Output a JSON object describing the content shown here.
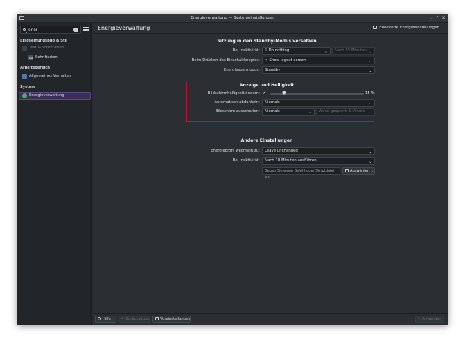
{
  "window": {
    "title": "Energieverwaltung — Systemeinstellungen"
  },
  "sidebar": {
    "search_value": "ener",
    "sections": [
      {
        "label": "Erscheinungsbild & Stil"
      },
      {
        "label": "Arbeitsbereich"
      },
      {
        "label": "System"
      }
    ],
    "items": [
      {
        "label": "Text & Schriftarten"
      },
      {
        "label": "Schriftarten"
      },
      {
        "label": "Allgemeines Verhalten"
      },
      {
        "label": "Energieverwaltung"
      }
    ]
  },
  "main": {
    "title": "Energieverwaltung",
    "advanced_button": "Erweiterte Energieeinstellungen …"
  },
  "standby": {
    "title": "Sitzung in den Standby-Modus versetzen",
    "rows": [
      {
        "label": "Bei Inaktivität:",
        "value": "Do nothing",
        "secondary": "Nach 25 Minuten"
      },
      {
        "label": "Beim Drücken des Einschaltknopfes:",
        "value": "Show logout screen"
      },
      {
        "label": "Energiesparmodus:",
        "value": "Standby"
      }
    ]
  },
  "display": {
    "title": "Anzeige und Helligkeit",
    "brightness_label": "Bildschirmhelligkeit ändern:",
    "brightness_check": "✔",
    "brightness_value": "15 %",
    "brightness_level": 0.15,
    "dim_label": "Automatisch abdunkeln:",
    "dim_value": "Niemals",
    "off_label": "Bildschirm ausschalten:",
    "off_value": "Niemals",
    "off_secondary": "Wenn gesperrt: 1 Minute"
  },
  "other": {
    "title": "Andere Einstellungen",
    "profile_label": "Energieprofil wechseln zu:",
    "profile_value": "Leave unchanged",
    "inactivity_label": "Bei Inaktivität:",
    "inactivity_value": "Nach 10 Minuten ausführen",
    "command_placeholder": "Geben Sie einen Befehl oder Skriptdatei ein",
    "choose_button": "Auswählen …"
  },
  "footer": {
    "help": "Hilfe",
    "reset": "Zurücksetzen",
    "defaults": "Voreinstellungen",
    "apply": "Anwenden"
  },
  "colors": {
    "accent": "#3b2f59",
    "highlight_border": "#c8102e"
  }
}
